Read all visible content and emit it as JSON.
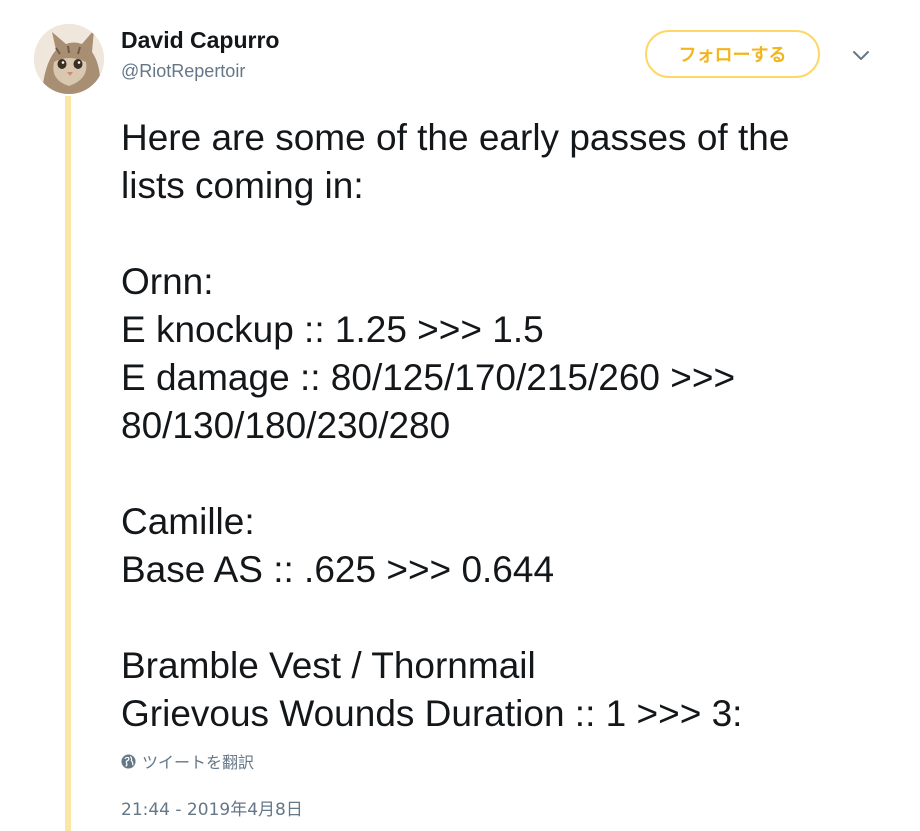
{
  "author": {
    "display_name": "David Capurro",
    "screen_name": "@RiotRepertoir"
  },
  "follow_button": {
    "label": "フォローする"
  },
  "tweet": {
    "lines": [
      "Here are some of the early passes of the",
      "lists coming in:",
      "",
      "Ornn:",
      "E knockup :: 1.25 >>> 1.5",
      "E damage :: 80/125/170/215/260 >>>",
      "80/130/180/230/280",
      "",
      "Camille:",
      "Base AS :: .625 >>> 0.644",
      "",
      "Bramble Vest / Thornmail",
      "Grievous Wounds Duration :: 1 >>> 3:"
    ]
  },
  "translate": {
    "label": "ツイートを翻訳",
    "icon": "globe-icon"
  },
  "timestamp": "21:44 - 2019年4月8日",
  "colors": {
    "accent": "#f3b51c",
    "accent_border": "#ffd766",
    "thread_line": "#fbe6a7",
    "secondary_text": "#657786",
    "primary_text": "#14171a"
  }
}
